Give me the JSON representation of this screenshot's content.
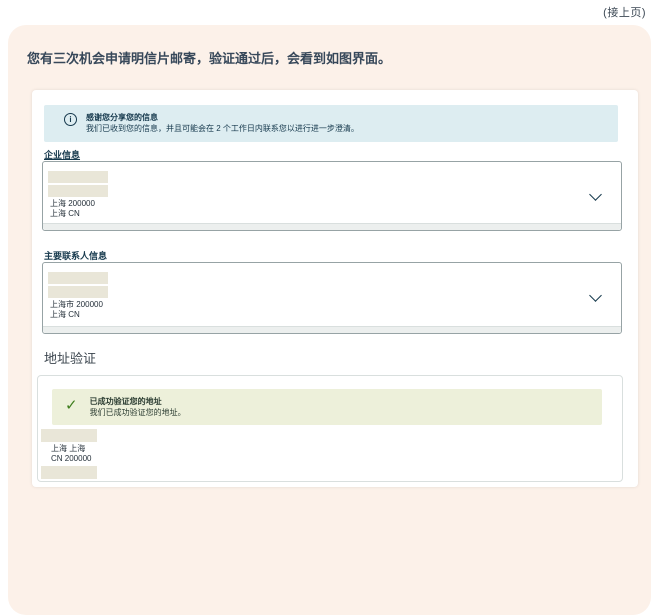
{
  "page": {
    "continued_note": "(接上页)",
    "heading": "您有三次机会申请明信片邮寄，验证通过后，会看到如图界面。"
  },
  "info_banner": {
    "icon": "info-circle-icon",
    "icon_glyph": "i",
    "title": "感谢您分享您的信息",
    "description": "我们已收到您的信息，并且可能会在 2 个工作日内联系您以进行进一步澄清。"
  },
  "business_info": {
    "label": "企业信息",
    "address_lines": [
      "上海 200000",
      "上海 CN"
    ],
    "expander_icon": "chevron-down-icon"
  },
  "contact_info": {
    "label": "主要联系人信息",
    "address_lines": [
      "上海市 200000",
      "上海 CN"
    ],
    "expander_icon": "chevron-down-icon"
  },
  "address_verification": {
    "title": "地址验证",
    "success_banner": {
      "icon": "checkmark-icon",
      "icon_glyph": "✓",
      "title": "已成功验证您的地址",
      "description": "我们已成功验证您的地址。"
    },
    "address_lines": [
      "上海 上海",
      "CN 200000"
    ]
  },
  "colors": {
    "card_background": "#fcf1e9",
    "info_banner_background": "#ddedf1",
    "success_banner_background": "#edf0da",
    "accent_text": "#16394d",
    "checkmark_green": "#3f7e1e",
    "redaction_bar": "#e9e6d8"
  }
}
